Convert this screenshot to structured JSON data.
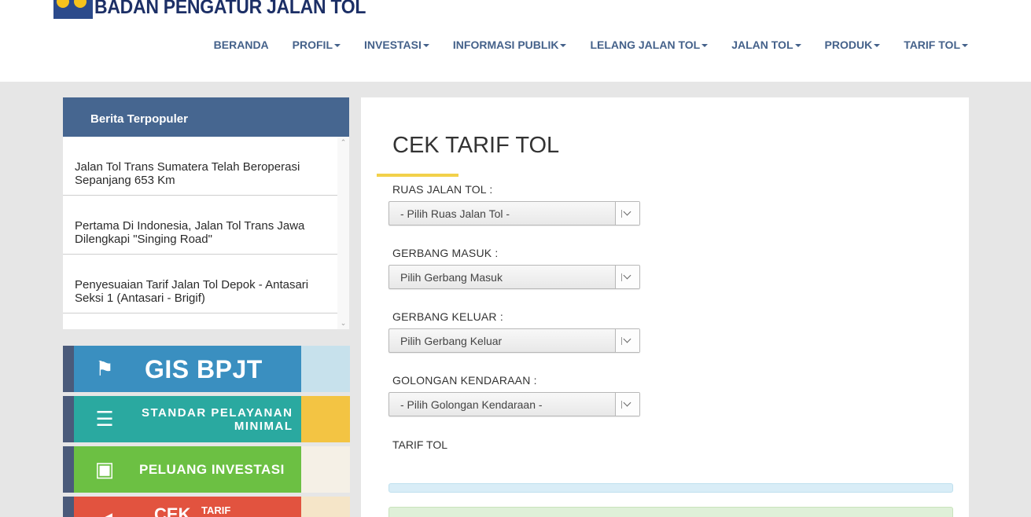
{
  "header": {
    "logo_text": "BADAN PENGATUR JALAN TOL"
  },
  "nav": {
    "items": [
      {
        "label": "BERANDA",
        "has_dropdown": false
      },
      {
        "label": "PROFIL",
        "has_dropdown": true
      },
      {
        "label": "INVESTASI",
        "has_dropdown": true
      },
      {
        "label": "INFORMASI PUBLIK",
        "has_dropdown": true
      },
      {
        "label": "LELANG JALAN TOL",
        "has_dropdown": true
      },
      {
        "label": "JALAN TOL",
        "has_dropdown": true
      },
      {
        "label": "PRODUK",
        "has_dropdown": true
      },
      {
        "label": "TARIF TOL",
        "has_dropdown": true
      }
    ]
  },
  "sidebar": {
    "news_title": "Berita Terpopuler",
    "news": [
      "Jalan Tol Trans Sumatera Telah Beroperasi Sepanjang 653 Km",
      "Pertama Di Indonesia, Jalan Tol Trans Jawa Dilengkapi \"Singing Road\"",
      "Penyesuaian Tarif Jalan Tol Depok - Antasari Seksi 1 (Antasari - Brigif)"
    ],
    "banners": {
      "gis": "GIS BPJT",
      "spm_line1": "STANDAR PELAYANAN",
      "spm_line2": "MINIMAL",
      "investasi": "PELUANG INVESTASI",
      "cek": "CEK",
      "cek_sub": "TARIF"
    }
  },
  "main": {
    "title": "CEK TARIF TOL",
    "ruas_label": "RUAS JALAN TOL :",
    "ruas_value": "- Pilih Ruas Jalan Tol -",
    "masuk_label": "GERBANG MASUK :",
    "masuk_value": "Pilih Gerbang Masuk",
    "keluar_label": "GERBANG KELUAR :",
    "keluar_value": "Pilih Gerbang Keluar",
    "golongan_label": "GOLONGAN KENDARAAN :",
    "golongan_value": "- Pilih Golongan Kendaraan -",
    "tarif_label": "TARIF TOL"
  },
  "colors": {
    "nav_text": "#44618a",
    "sidebar_header": "#466690",
    "title_underline": "#f2d14a"
  }
}
